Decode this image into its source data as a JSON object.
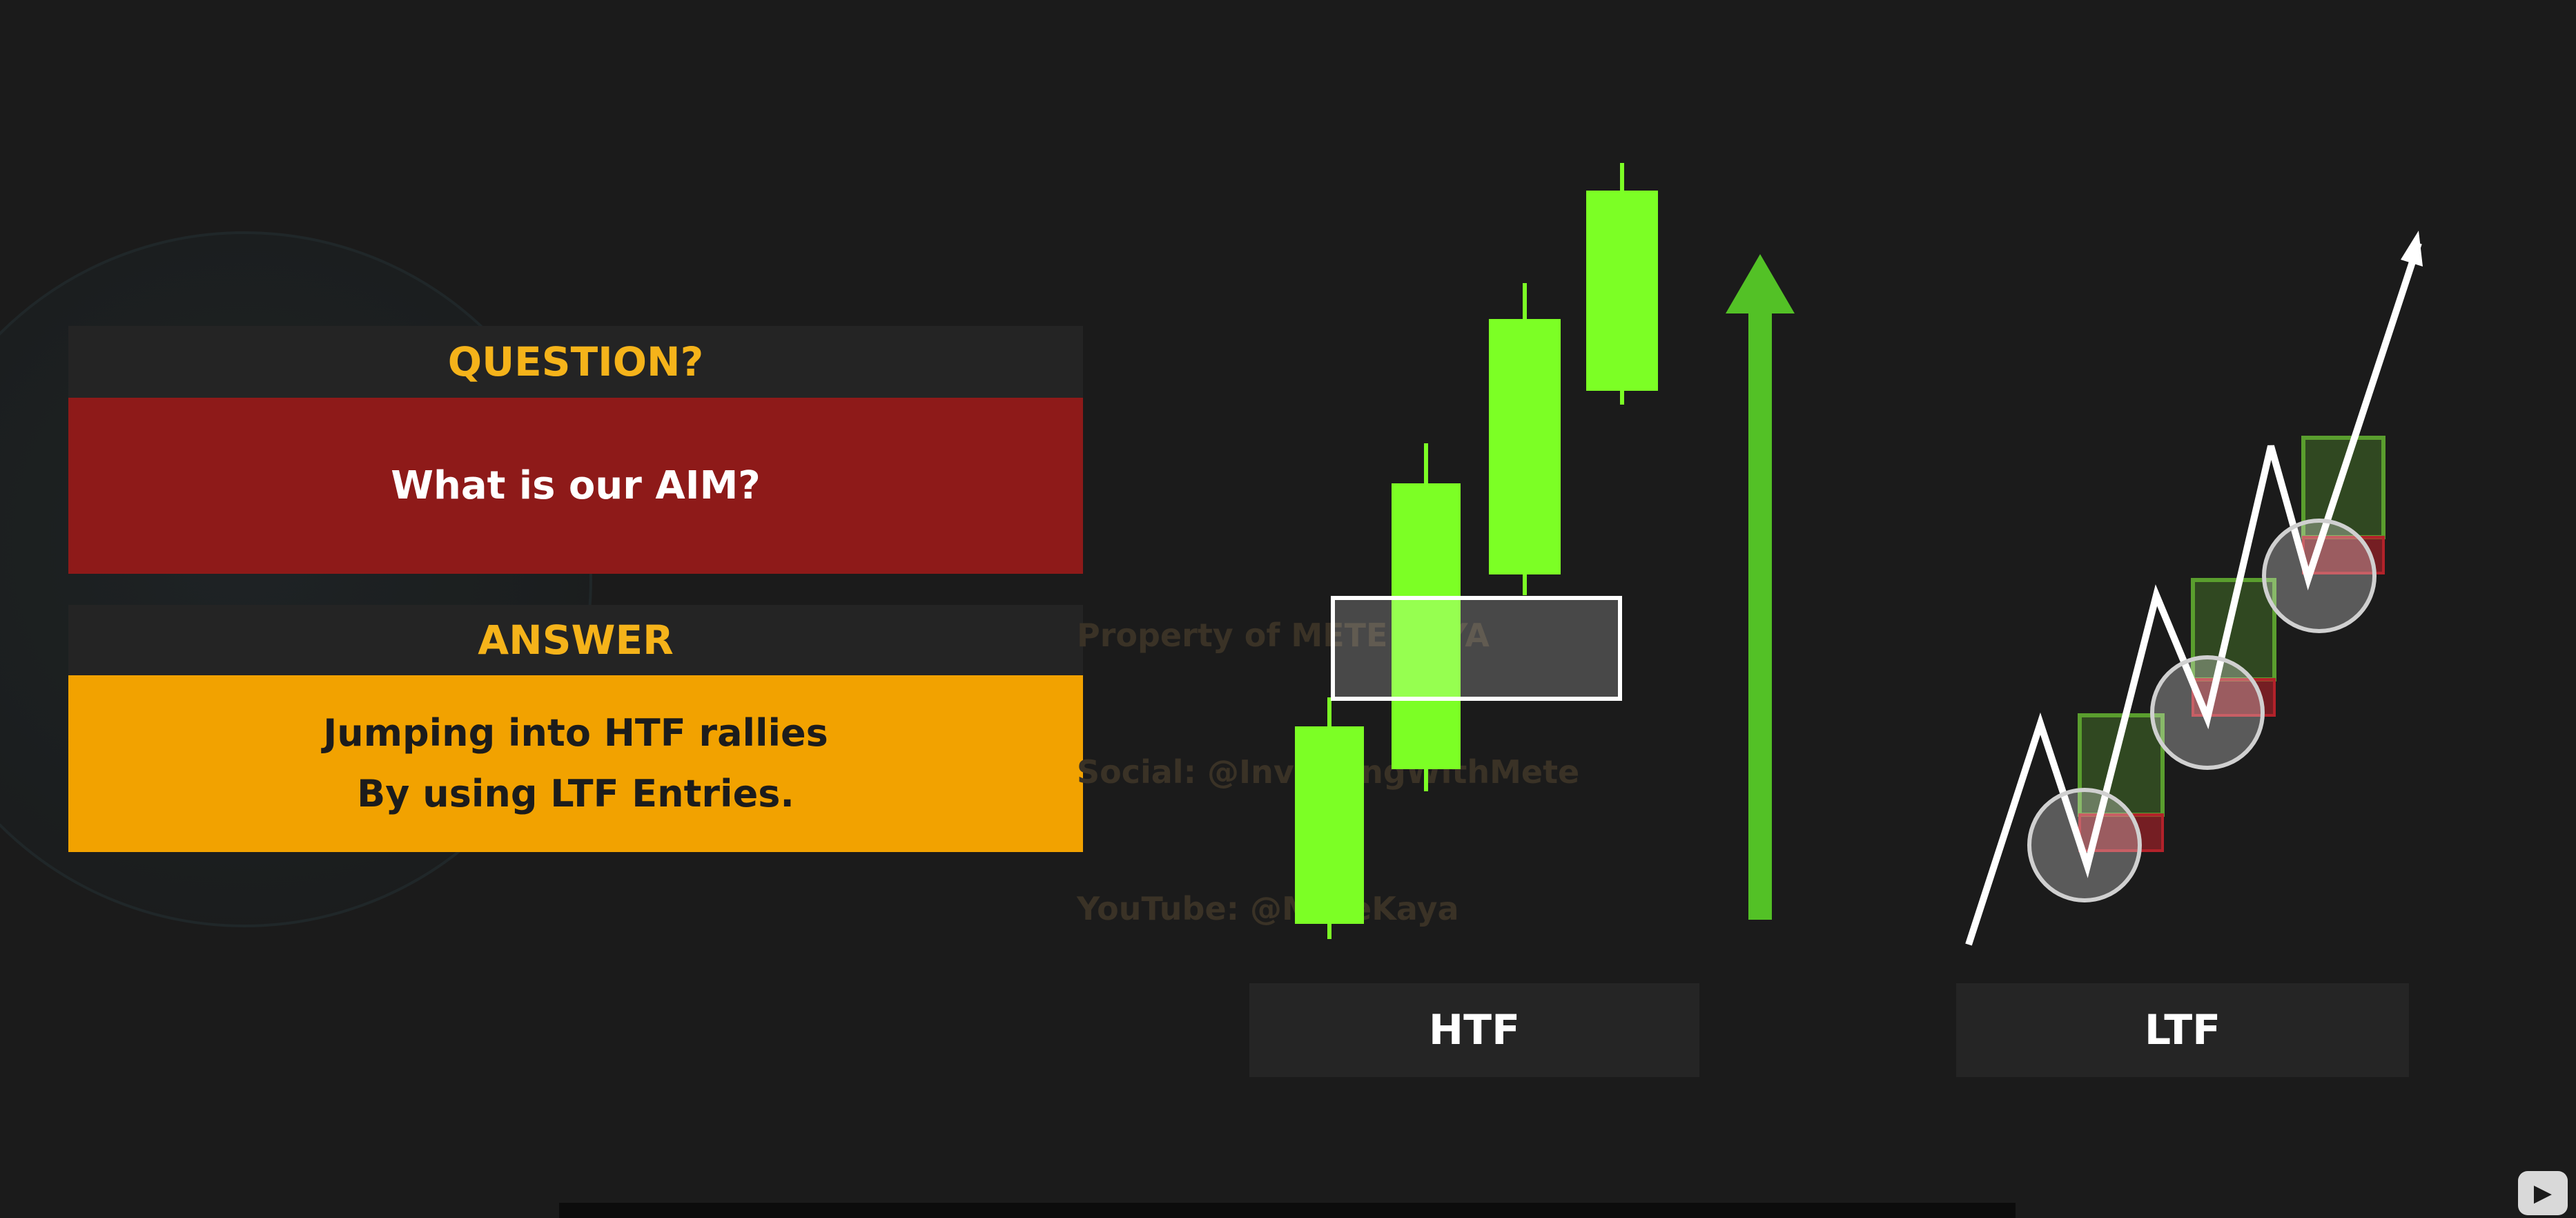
{
  "question": {
    "header": "QUESTION?",
    "text": "What is our AIM?"
  },
  "answer": {
    "header": "ANSWER",
    "line1": "Jumping into HTF rallies",
    "line2": "By using LTF Entries."
  },
  "watermark": {
    "line1": "Property of METE KAYA",
    "line2": "Social: @InvestingWithMete",
    "line3": "YouTube: @MeteKaya"
  },
  "labels": {
    "htf": "HTF",
    "ltf": "LTF"
  },
  "colors": {
    "background": "#1b1b1b",
    "header_bg": "#242424",
    "header_text": "#f5b31a",
    "question_bg": "#8e1a19",
    "answer_bg": "#f2a200",
    "candle": "#7cff25",
    "arrow": "#53c126",
    "zone_box": "#ffffff",
    "demand_zone": "#5a9e2e",
    "stop_zone": "#b3222a"
  },
  "icons": {
    "up_arrow": "up-arrow-icon",
    "player": "play-icon"
  }
}
